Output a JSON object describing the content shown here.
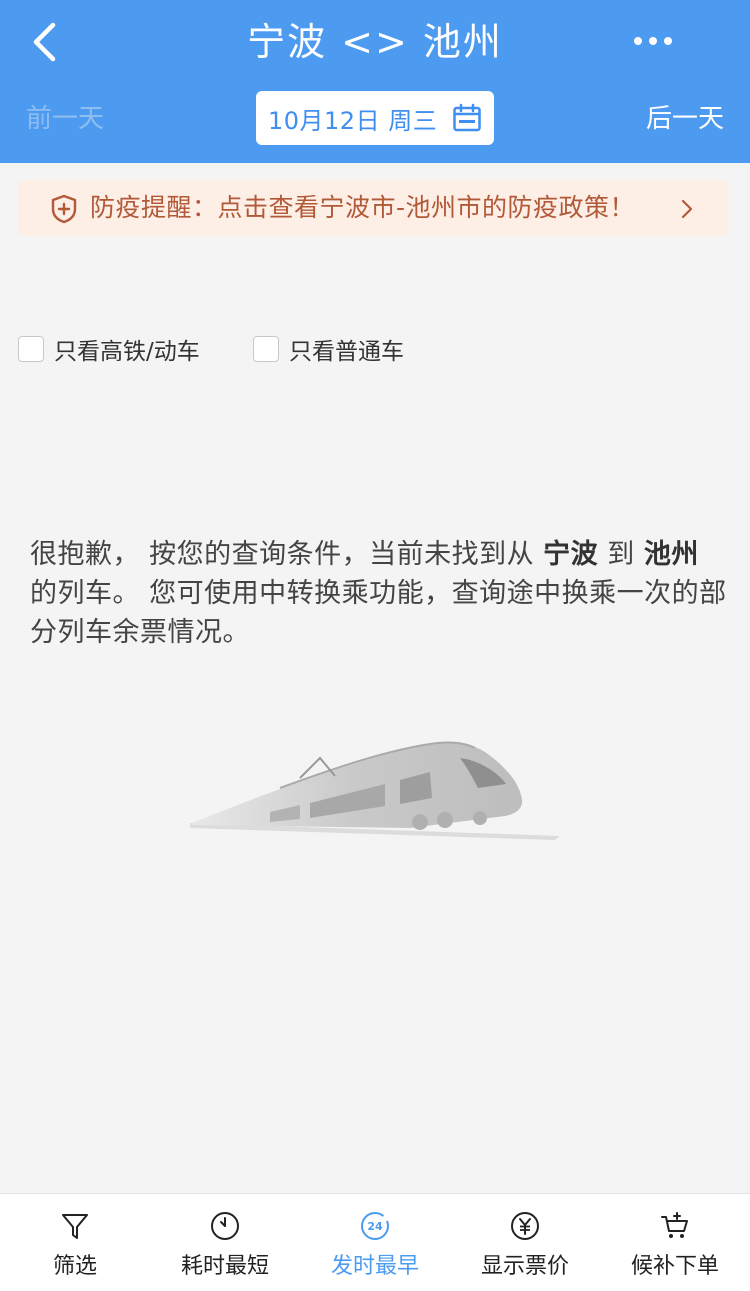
{
  "header": {
    "title": "宁波 <> 池州",
    "prev_day": "前一天",
    "next_day": "后一天",
    "date": "10月12日 周三"
  },
  "notice": {
    "text": "防疫提醒：点击查看宁波市-池州市的防疫政策！"
  },
  "filters": [
    {
      "label": "只看高铁/动车",
      "checked": false
    },
    {
      "label": "只看普通车",
      "checked": false
    }
  ],
  "empty_message": {
    "part1": "很抱歉， 按您的查询条件，当前未找到从 ",
    "from": "宁波",
    "part2": " 到 ",
    "to": "池州",
    "part3": " 的列车。 您可使用中转换乘功能，查询途中换乘一次的部分列车余票情况。"
  },
  "tabbar": [
    {
      "label": "筛选",
      "icon": "filter-icon"
    },
    {
      "label": "耗时最短",
      "icon": "timer-icon"
    },
    {
      "label": "发时最早",
      "icon": "24h-clock-icon",
      "badge": "24",
      "active": true
    },
    {
      "label": "显示票价",
      "icon": "yuan-icon"
    },
    {
      "label": "候补下单",
      "icon": "cart-plus-icon"
    }
  ],
  "colors": {
    "header_bg": "#4c9bf0",
    "accent": "#3f8ef0",
    "notice_bg": "#fdeee6",
    "notice_text": "#b25a38",
    "page_bg": "#f4f4f4"
  }
}
